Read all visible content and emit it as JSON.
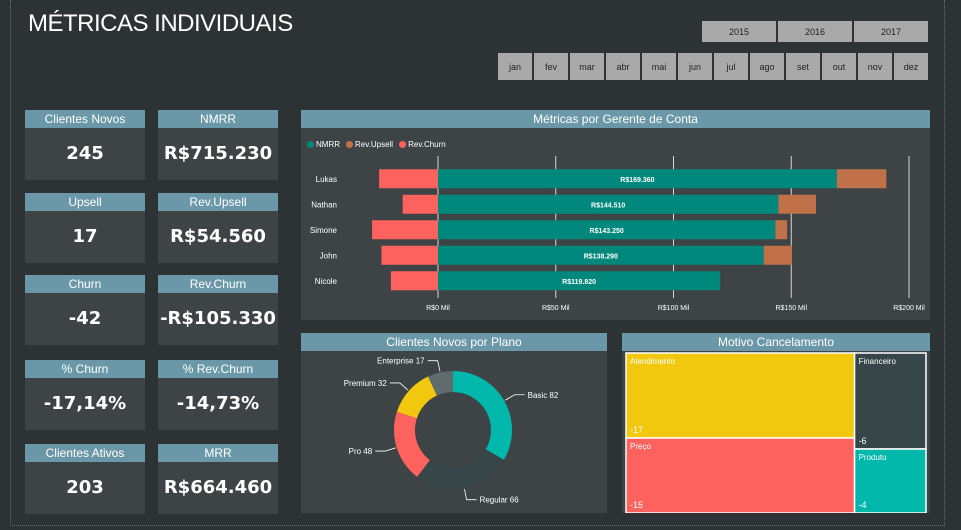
{
  "page_title": "MÉTRICAS INDIVIDUAIS",
  "years": [
    "2015",
    "2016",
    "2017"
  ],
  "months": [
    "jan",
    "fev",
    "mar",
    "abr",
    "mai",
    "jun",
    "jul",
    "ago",
    "set",
    "out",
    "nov",
    "dez"
  ],
  "cards": [
    {
      "label": "Clientes Novos",
      "value": "245"
    },
    {
      "label": "NMRR",
      "value": "R$715.230"
    },
    {
      "label": "Upsell",
      "value": "17"
    },
    {
      "label": "Rev.Upsell",
      "value": "R$54.560"
    },
    {
      "label": "Churn",
      "value": "-42"
    },
    {
      "label": "Rev.Churn",
      "value": "-R$105.330"
    },
    {
      "label": "% Churn",
      "value": "-17,14%"
    },
    {
      "label": "% Rev.Churn",
      "value": "-14,73%"
    },
    {
      "label": "Clientes Ativos",
      "value": "203"
    },
    {
      "label": "MRR",
      "value": "R$664.460"
    }
  ],
  "colors": {
    "nmrr": "#01887d",
    "upsell": "#c0714a",
    "churn": "#fd625e",
    "header": "#6a98a8",
    "card_bg": "#3e4446",
    "yellow": "#f2c80f",
    "teal": "#01b8aa",
    "dark": "#374649",
    "gray": "#5f6b6d"
  },
  "chart_data": [
    {
      "type": "bar",
      "title": "Métricas por Gerente de Conta",
      "legend_position": "top-left",
      "categories": [
        "Lukas",
        "Nathan",
        "Simone",
        "John",
        "Nicole"
      ],
      "series": [
        {
          "name": "NMRR",
          "values": [
            169360,
            144510,
            143250,
            138290,
            119820
          ],
          "labels": [
            "R$169.360",
            "R$144.510",
            "R$143.250",
            "R$138.290",
            "R$119.820"
          ]
        },
        {
          "name": "Rev.Upsell",
          "values": [
            21000,
            16000,
            5000,
            12000,
            0
          ]
        },
        {
          "name": "Rev.Churn",
          "values": [
            -25000,
            -15000,
            -28000,
            -24000,
            -20000
          ]
        }
      ],
      "x_ticks": [
        "R$0 Mil",
        "R$50 Mil",
        "R$100 Mil",
        "R$150 Mil",
        "R$200 Mil"
      ],
      "xlim": [
        -28000,
        200000
      ],
      "grid": true
    },
    {
      "type": "pie",
      "title": "Clientes Novos por Plano",
      "slices": [
        {
          "label": "Basic",
          "value": 82,
          "text": "Basic 82"
        },
        {
          "label": "Regular",
          "value": 66,
          "text": "Regular 66"
        },
        {
          "label": "Pro",
          "value": 48,
          "text": "Pro 48"
        },
        {
          "label": "Premium",
          "value": 32,
          "text": "Premium 32"
        },
        {
          "label": "Enterprise",
          "value": 17,
          "text": "Enterprise 17"
        }
      ]
    },
    {
      "type": "treemap",
      "title": "Motivo Cancelamento",
      "items": [
        {
          "label": "Atendimento",
          "value": -17,
          "value_text": "-17"
        },
        {
          "label": "Preço",
          "value": -15,
          "value_text": "-15"
        },
        {
          "label": "Financeiro",
          "value": -6,
          "value_text": "-6"
        },
        {
          "label": "Produto",
          "value": -4,
          "value_text": "-4"
        }
      ]
    }
  ]
}
